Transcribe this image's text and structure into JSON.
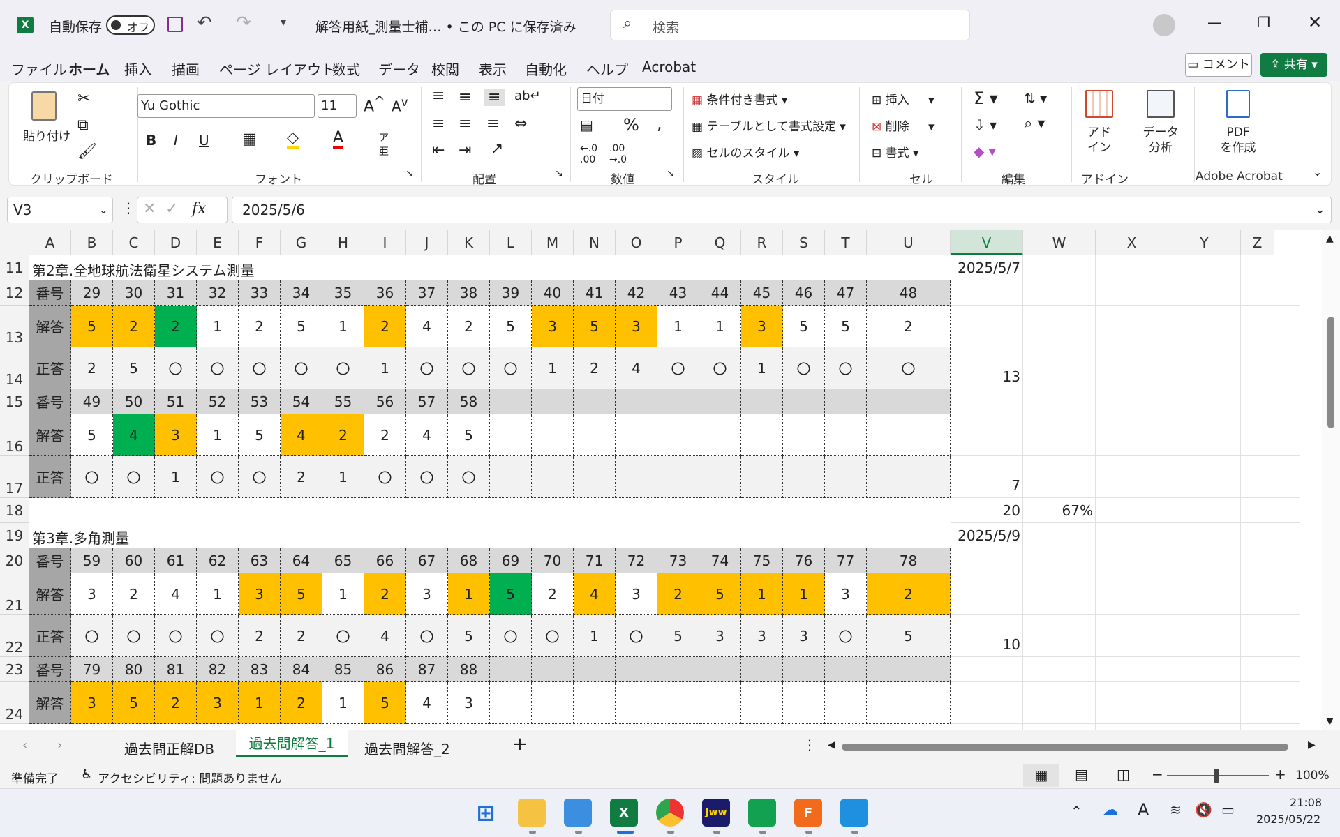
{
  "title": {
    "autosave_label": "自動保存",
    "autosave_state": "オフ",
    "filename": "解答用紙_測量士補… • この PC に保存済み",
    "search_placeholder": "検索"
  },
  "menu": [
    "ファイル",
    "ホーム",
    "挿入",
    "描画",
    "ページ レイアウト",
    "数式",
    "データ",
    "校閲",
    "表示",
    "自動化",
    "ヘルプ",
    "Acrobat"
  ],
  "menu_right": {
    "comment": "コメント",
    "share": "共有"
  },
  "ribbon": {
    "clipboard": {
      "paste": "貼り付け",
      "label": "クリップボード"
    },
    "font": {
      "name": "Yu Gothic",
      "size": "11",
      "label": "フォント"
    },
    "alignment": {
      "label": "配置"
    },
    "number": {
      "format": "日付",
      "label": "数値"
    },
    "styles": {
      "conditional": "条件付き書式",
      "table": "テーブルとして書式設定",
      "cell": "セルのスタイル",
      "label": "スタイル"
    },
    "cells": {
      "insert": "挿入",
      "delete": "削除",
      "format": "書式",
      "label": "セル"
    },
    "editing": {
      "label": "編集"
    },
    "addin": {
      "l1": "アド",
      "l2": "イン",
      "label": "アドイン"
    },
    "analysis": {
      "l1": "データ",
      "l2": "分析"
    },
    "acrobat": {
      "l1": "PDF",
      "l2": "を作成",
      "label": "Adobe Acrobat"
    }
  },
  "formula": {
    "namebox": "V3",
    "fx": "fx",
    "value": "2025/5/6"
  },
  "columns": [
    "A",
    "B",
    "C",
    "D",
    "E",
    "F",
    "G",
    "H",
    "I",
    "J",
    "K",
    "L",
    "M",
    "N",
    "O",
    "P",
    "Q",
    "R",
    "S",
    "T",
    "U",
    "V",
    "W",
    "X",
    "Y",
    "Z",
    "A"
  ],
  "rows": [
    "11",
    "12",
    "13",
    "14",
    "15",
    "16",
    "17",
    "18",
    "19",
    "20",
    "21",
    "22",
    "23",
    "24"
  ],
  "sheet": {
    "s2_title": "第2章.全地球航法衛星システム測量",
    "s2_date": "2025/5/7",
    "lbl_num": "番号",
    "lbl_ans": "解答",
    "lbl_cor": "正答",
    "r12": [
      "29",
      "30",
      "31",
      "32",
      "33",
      "34",
      "35",
      "36",
      "37",
      "38",
      "39",
      "40",
      "41",
      "42",
      "43",
      "44",
      "45",
      "46",
      "47",
      "48"
    ],
    "r13": [
      "5",
      "2",
      "2",
      "1",
      "2",
      "5",
      "1",
      "2",
      "4",
      "2",
      "5",
      "3",
      "5",
      "3",
      "1",
      "1",
      "3",
      "5",
      "5",
      "2"
    ],
    "r14": [
      "2",
      "5",
      "〇",
      "〇",
      "〇",
      "〇",
      "〇",
      "1",
      "〇",
      "〇",
      "〇",
      "1",
      "2",
      "4",
      "〇",
      "〇",
      "1",
      "〇",
      "〇",
      "〇"
    ],
    "v14": "13",
    "r15": [
      "49",
      "50",
      "51",
      "52",
      "53",
      "54",
      "55",
      "56",
      "57",
      "58"
    ],
    "r16": [
      "5",
      "4",
      "3",
      "1",
      "5",
      "4",
      "2",
      "2",
      "4",
      "5"
    ],
    "r17": [
      "〇",
      "〇",
      "1",
      "〇",
      "〇",
      "2",
      "1",
      "〇",
      "〇",
      "〇"
    ],
    "v17": "7",
    "v18": "20",
    "w18": "67%",
    "s3_title": "第3章.多角測量",
    "s3_date": "2025/5/9",
    "r20": [
      "59",
      "60",
      "61",
      "62",
      "63",
      "64",
      "65",
      "66",
      "67",
      "68",
      "69",
      "70",
      "71",
      "72",
      "73",
      "74",
      "75",
      "76",
      "77",
      "78"
    ],
    "r21": [
      "3",
      "2",
      "4",
      "1",
      "3",
      "5",
      "1",
      "2",
      "3",
      "1",
      "5",
      "2",
      "4",
      "3",
      "2",
      "5",
      "1",
      "1",
      "3",
      "2"
    ],
    "r22": [
      "〇",
      "〇",
      "〇",
      "〇",
      "2",
      "2",
      "〇",
      "4",
      "〇",
      "5",
      "〇",
      "〇",
      "1",
      "〇",
      "5",
      "3",
      "3",
      "3",
      "〇",
      "5"
    ],
    "v22": "10",
    "r23": [
      "79",
      "80",
      "81",
      "82",
      "83",
      "84",
      "85",
      "86",
      "87",
      "88"
    ],
    "r24": [
      "3",
      "5",
      "2",
      "3",
      "1",
      "2",
      "1",
      "5",
      "4",
      "3"
    ]
  },
  "tabs": [
    "過去問正解DB",
    "過去問解答_1",
    "過去問解答_2"
  ],
  "status": {
    "ready": "準備完了",
    "accessibility": "アクセシビリティ: 問題ありません",
    "zoom": "100%"
  },
  "clock": {
    "time": "21:08",
    "date": "2025/05/22"
  },
  "colors": {
    "accent": "#107c41",
    "yellow": "#ffc000",
    "green": "#00b050"
  }
}
